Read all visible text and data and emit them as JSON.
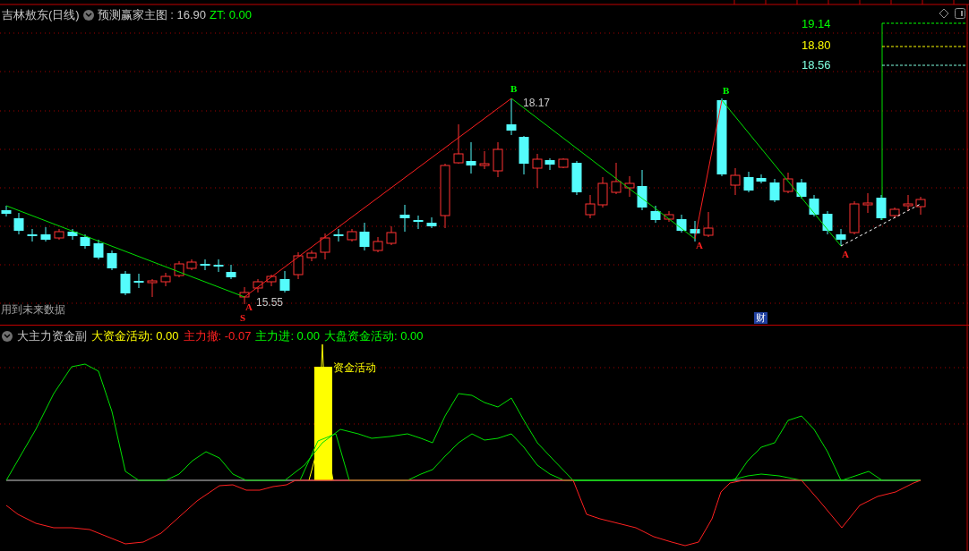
{
  "main_panel": {
    "stock_title": "吉林敖东(日线)",
    "indicator_name": "预测赢家主图 : 16.90",
    "zt": "ZT: 0.00",
    "price_levels": [
      {
        "label": "19.14",
        "color": "#00ff00"
      },
      {
        "label": "18.80",
        "color": "#ffff00"
      },
      {
        "label": "18.56",
        "color": "#80ffe0"
      }
    ],
    "markers": [
      {
        "kind": "peak",
        "label": "B"
      },
      {
        "kind": "price",
        "label": "18.17"
      },
      {
        "kind": "trough",
        "label": "A"
      },
      {
        "kind": "price",
        "label": "15.55"
      },
      {
        "kind": "sell",
        "label": "S"
      },
      {
        "kind": "peak",
        "label": "B"
      },
      {
        "kind": "trough",
        "label": "A"
      },
      {
        "kind": "trough",
        "label": "A"
      }
    ],
    "note": "用到未来数据",
    "badge": "财"
  },
  "sub_panel": {
    "title": "大主力资金副",
    "values": [
      {
        "label": "大资金活动: 0.00",
        "color": "#ffff00"
      },
      {
        "label": "主力撤: -0.07",
        "color": "#ff2020"
      },
      {
        "label": "主力进: 0.00",
        "color": "#00ff00"
      },
      {
        "label": "大盘资金活动: 0.00",
        "color": "#00ff00"
      }
    ],
    "bar_label": "资金活动"
  }
}
